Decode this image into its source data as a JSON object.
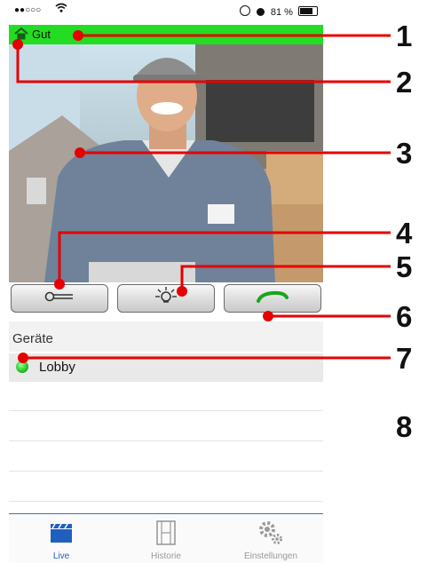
{
  "status_bar": {
    "signal": "●●○○○",
    "right": "81 %"
  },
  "connection": {
    "label": "Gut"
  },
  "controls": {
    "key": "O─=",
    "light": "light",
    "call": "call"
  },
  "devices": {
    "header": "Geräte",
    "items": [
      {
        "name": "Lobby",
        "status": "online"
      }
    ]
  },
  "tabbar": {
    "tabs": [
      {
        "label": "Live",
        "active": true
      },
      {
        "label": "Historie",
        "active": false
      },
      {
        "label": "Einstellungen",
        "active": false
      }
    ]
  },
  "annotations": [
    "1",
    "2",
    "3",
    "4",
    "5",
    "6",
    "7",
    "8"
  ],
  "colors": {
    "connection_good": "#22dd22",
    "callout_line": "#e60000",
    "active_tab": "#1f5fbf"
  }
}
